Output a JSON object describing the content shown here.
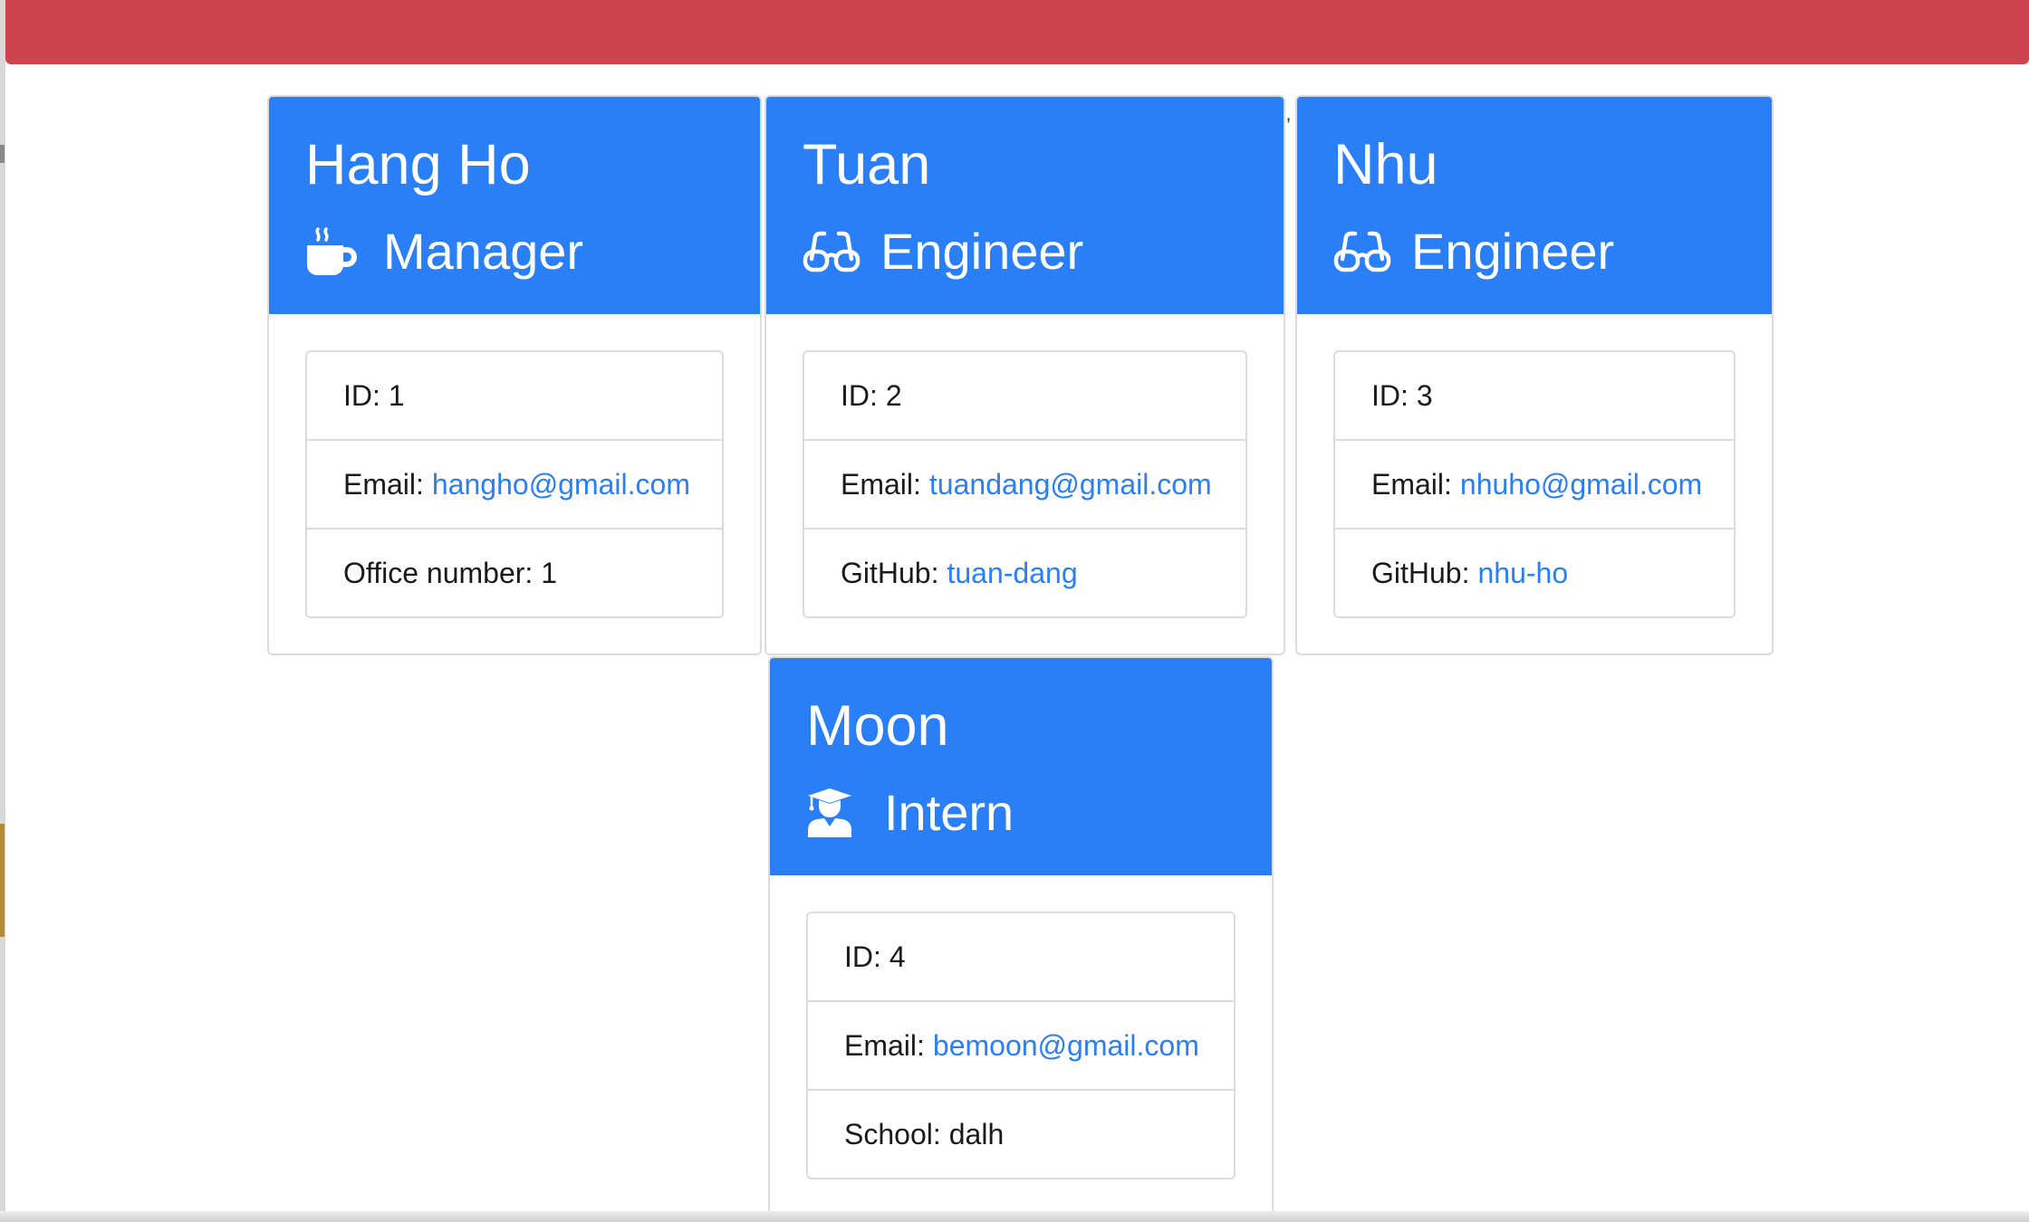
{
  "employees": [
    {
      "name": "Hang Ho",
      "role": "Manager",
      "icon": "coffee-icon",
      "id_label": "ID:",
      "id": "1",
      "email_label": "Email:",
      "email": "hangho@gmail.com",
      "extra_label": "Office number:",
      "extra_value": "1"
    },
    {
      "name": "Tuan",
      "role": "Engineer",
      "icon": "glasses-icon",
      "id_label": "ID:",
      "id": "2",
      "email_label": "Email:",
      "email": "tuandang@gmail.com",
      "extra_label": "GitHub:",
      "extra_value": "tuan-dang"
    },
    {
      "name": "Nhu",
      "role": "Engineer",
      "icon": "glasses-icon",
      "id_label": "ID:",
      "id": "3",
      "email_label": "Email:",
      "email": "nhuho@gmail.com",
      "extra_label": "GitHub:",
      "extra_value": "nhu-ho"
    },
    {
      "name": "Moon",
      "role": "Intern",
      "icon": "graduate-icon",
      "id_label": "ID:",
      "id": "4",
      "email_label": "Email:",
      "email": "bemoon@gmail.com",
      "extra_label": "School:",
      "extra_value": "dalh"
    }
  ],
  "colors": {
    "header_bar": "#cd444f",
    "card_header": "#2a7ff6",
    "link": "#2a7ff6"
  }
}
